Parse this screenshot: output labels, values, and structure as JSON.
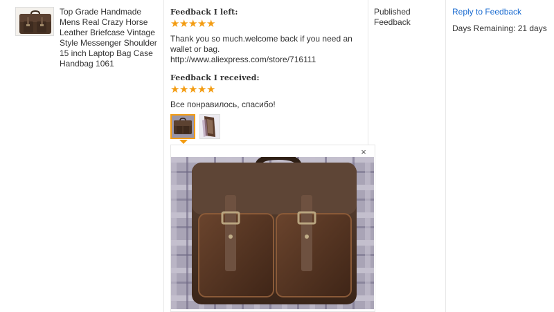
{
  "product": {
    "title": "Top Grade Handmade Mens Real Crazy Horse Leather Briefcase Vintage Style Messenger Shoulder 15 inch Laptop Bag Case Handbag 1061"
  },
  "feedback_left": {
    "label": "Feedback I left:",
    "rating": 5,
    "text": "Thank you so much.welcome back if you need an wallet or bag. http://www.aliexpress.com/store/716111"
  },
  "feedback_received": {
    "label": "Feedback I received:",
    "rating": 5,
    "text": "Все понравилось, спасибо!"
  },
  "status": {
    "text": "Published Feedback"
  },
  "actions": {
    "reply_label": "Reply to Feedback",
    "days_remaining": "Days Remaining: 21 days"
  },
  "preview": {
    "close_glyph": "×"
  },
  "colors": {
    "star": "#f39c12",
    "link": "#1a6bd0",
    "active_border": "#f39c12"
  },
  "icons": [
    "star-icon",
    "close-icon",
    "caret-down-icon"
  ]
}
